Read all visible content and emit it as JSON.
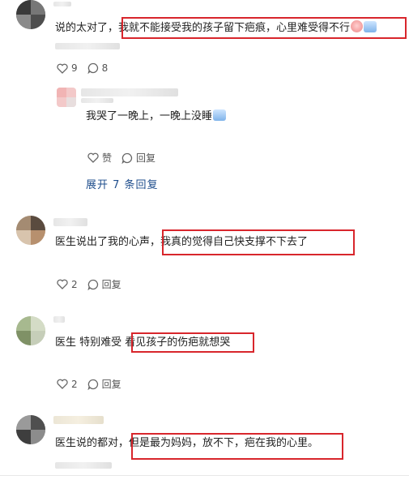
{
  "comments": [
    {
      "text_before": "说的太对了，",
      "text_highlight": "我就不能接受我的孩子留下疤痕，心里难受得不行",
      "likes": "9",
      "replies": "8"
    },
    {
      "reply_text": "我哭了一晚上，一晚上没睡",
      "like_label": "赞",
      "reply_label": "回复",
      "expand_label": "展开 7 条回复"
    },
    {
      "text_before": "医生说出了我的心声，",
      "text_highlight": "我真的觉得自己快支撑不下去了",
      "likes": "2",
      "reply_label": "回复"
    },
    {
      "text_before": "医生 特别难受 ",
      "text_highlight": "看见孩子的伤疤就想哭",
      "likes": "2",
      "reply_label": "回复"
    },
    {
      "text_before": "医生说的都对，",
      "text_highlight": "但是最为妈妈，放不下，疤在我的心里。"
    }
  ],
  "icons": {
    "heart": "heart-icon",
    "comment": "comment-bubble-icon",
    "emoji_face": "crying-face-emoji",
    "emoji_cry": "sad-emoji"
  },
  "colors": {
    "highlight_border": "#d8262c",
    "link": "#1e4d8c"
  }
}
